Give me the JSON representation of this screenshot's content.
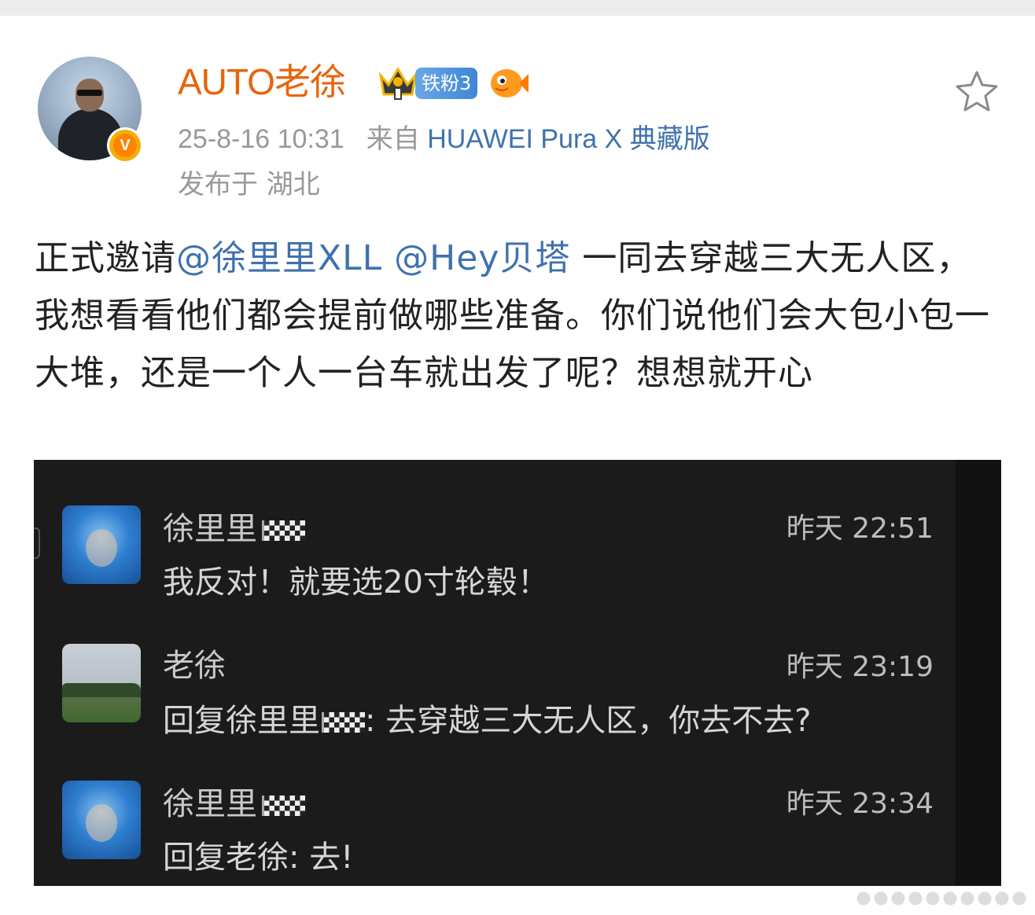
{
  "author": {
    "name": "AUTO老徐",
    "fan_badge": "铁粉3",
    "verified_mark": "V"
  },
  "meta": {
    "time": "25-8-16 10:31",
    "source_prefix": "来自",
    "source_device": "HUAWEI Pura X 典藏版",
    "location": "发布于 湖北"
  },
  "post": {
    "text_before": "正式邀请",
    "mention1": "@徐里里XLL",
    "mention2": "@Hey贝塔",
    "text_after": " 一同去穿越三大无人区，我想看看他们都会提前做哪些准备。你们说他们会大包小包一大堆，还是一个人一台车就出发了呢？想想就开心"
  },
  "chat": {
    "messages": [
      {
        "name": "徐里里",
        "time": "昨天 22:51",
        "text": "我反对！就要选20寸轮毂！"
      },
      {
        "name": "老徐",
        "time": "昨天 23:19",
        "text_prefix": "回复徐里里",
        "text": ": 去穿越三大无人区，你去不去?"
      },
      {
        "name": "徐里里",
        "time": "昨天 23:34",
        "text": "回复老徐: 去!"
      }
    ]
  },
  "colors": {
    "username": "#e8640c",
    "link": "#3f72ad",
    "meta": "#999999",
    "chat_bg": "#1b1b1c"
  },
  "icons": [
    "crown-icon",
    "fish-icon",
    "star-icon",
    "verified-icon",
    "checkered-flag-icon"
  ]
}
